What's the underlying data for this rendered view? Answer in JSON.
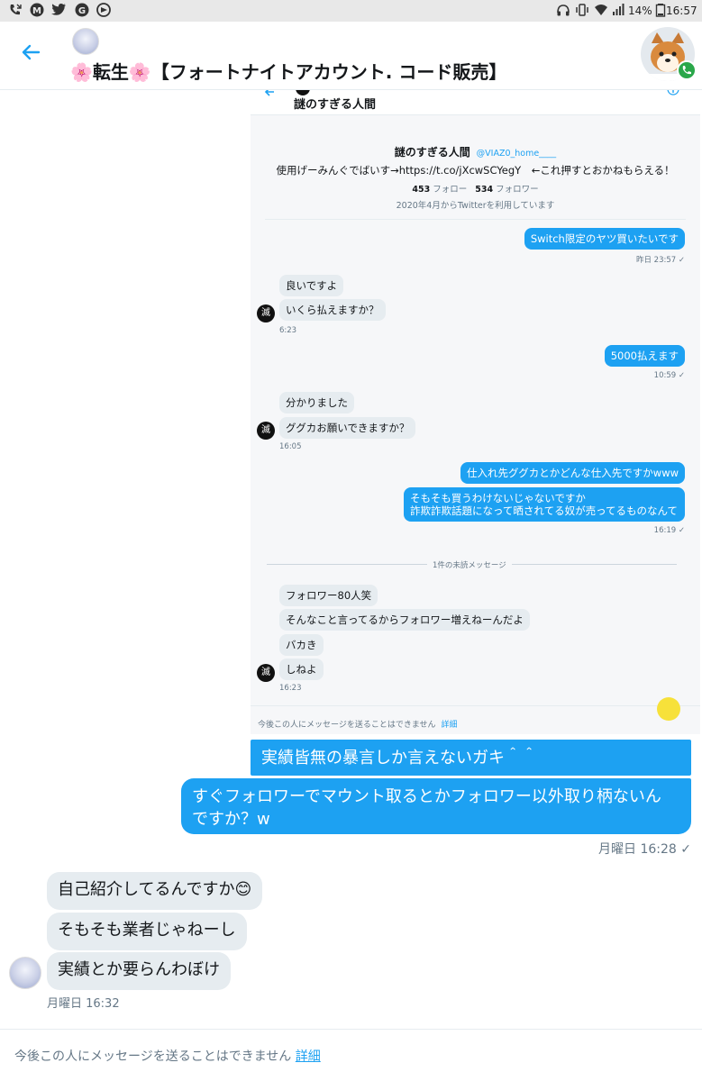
{
  "status_bar": {
    "battery": "14%",
    "time": "16:57"
  },
  "header": {
    "title": "🌸転生🌸【フォートナイトアカウント. コード販売】",
    "accent_color": "#1da1f2"
  },
  "embedded": {
    "name_top": "謎のすぎる人間",
    "profile": {
      "name": "謎のすぎる人間",
      "handle": "@VIAZ0_home____",
      "bio": "使用げーみんぐでばいす→https://t.co/jXcwSCYegY　←これ押すとおかねもらえる！",
      "following_count": "453",
      "following_label": "フォロー",
      "followers_count": "534",
      "followers_label": "フォロワー",
      "joined": "2020年4月からTwitterを利用しています"
    },
    "messages": {
      "out1": "Switch限定のヤツ買いたいです",
      "out1_time": "昨日 23:57",
      "in1a": "良いですよ",
      "in1b": "いくら払えますか？",
      "in1_time": "6:23",
      "out2": "5000払えます",
      "out2_time": "10:59",
      "in2a": "分かりました",
      "in2b": "ググカお願いできますか？",
      "in2_time": "16:05",
      "out3a": "仕入れ先ググカとかどんな仕入先ですかwww",
      "out3b_line1": "そもそも買うわけないじゃないですか",
      "out3b_line2": "詐欺詐欺話題になって晒されてる奴が売ってるものなんて",
      "out3_time": "16:19",
      "unread_divider": "1件の未読メッセージ",
      "in3a": "フォロワー80人笑",
      "in3b": "そんなこと言ってるからフォロワー増えねーんだよ",
      "in3c": "バカき",
      "in3d": "しねよ",
      "in3_time": "16:23",
      "avatar_char": "滅"
    },
    "footer_text": "今後この人にメッセージを送ることはできません",
    "footer_link": "詳細"
  },
  "chat": {
    "out1": "実績皆無の暴言しか言えないガキ＾＾",
    "out2_line1": "すぐフォロワーでマウント取るとかフォロワー以外取り柄ないん",
    "out2_line2": "ですか？w",
    "out_time": "月曜日 16:28",
    "in1": "自己紹介してるんですか😊",
    "in2": "そもそも業者じゃねーし",
    "in3": "実績とか要らんわぼけ",
    "in_time": "月曜日 16:32"
  },
  "footer": {
    "text": "今後この人にメッセージを送ることはできません",
    "link": "詳細"
  }
}
